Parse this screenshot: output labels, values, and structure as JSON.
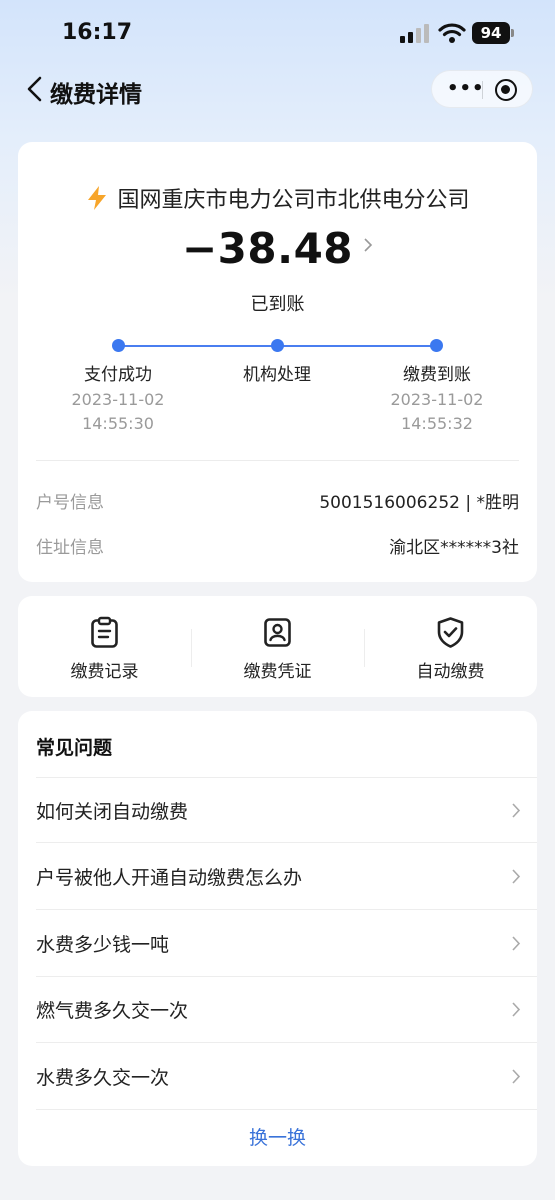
{
  "status_bar": {
    "time": "16:17",
    "battery": "94"
  },
  "nav": {
    "title": "缴费详情",
    "more_icon": "more-dots-icon",
    "close_icon": "target-icon"
  },
  "bill": {
    "merchant": "国网重庆市电力公司市北供电分公司",
    "amount": "−38.48",
    "status": "已到账",
    "accent_color": "#3b78f0",
    "steps": [
      {
        "label": "支付成功",
        "date": "2023-11-02",
        "time": "14:55:30"
      },
      {
        "label": "机构处理",
        "date": "",
        "time": ""
      },
      {
        "label": "缴费到账",
        "date": "2023-11-02",
        "time": "14:55:32"
      }
    ],
    "info": [
      {
        "label": "户号信息",
        "value": "5001516006252 | *胜明"
      },
      {
        "label": "住址信息",
        "value": "渝北区******3社"
      }
    ]
  },
  "actions": [
    {
      "label": "缴费记录",
      "icon": "clipboard-icon"
    },
    {
      "label": "缴费凭证",
      "icon": "receipt-person-icon"
    },
    {
      "label": "自动缴费",
      "icon": "shield-check-icon"
    }
  ],
  "faq": {
    "title": "常见问题",
    "items": [
      "如何关闭自动缴费",
      "户号被他人开通自动缴费怎么办",
      "水费多少钱一吨",
      "燃气费多久交一次",
      "水费多久交一次"
    ],
    "refresh_label": "换一换",
    "link_color": "#3a73d9"
  }
}
